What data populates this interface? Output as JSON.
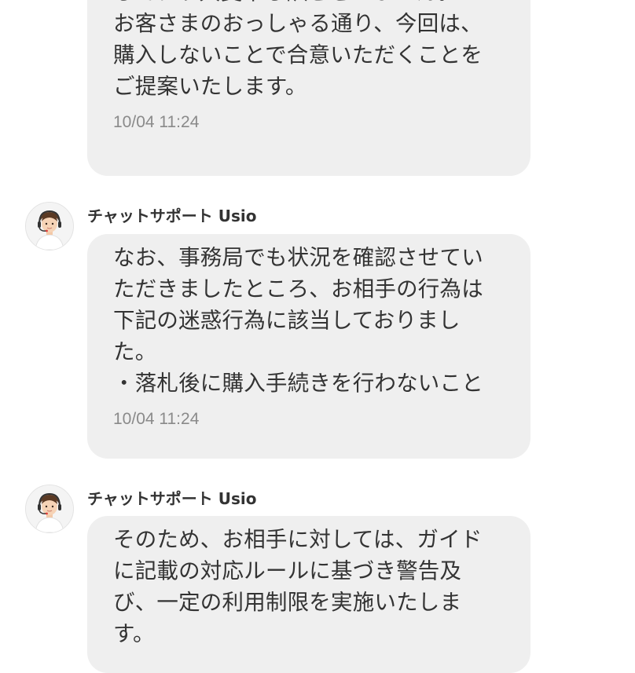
{
  "messages": [
    {
      "lines": [
        "しており大変申し訳ございません。",
        "お客さまのおっしゃる通り、今回は、",
        "購入しないことで合意いただくことを",
        "ご提案いたします。"
      ],
      "time": "10/04 11:24"
    },
    {
      "sender": "チャットサポート Usio",
      "avatar_icon": "support-agent-headset-icon",
      "lines": [
        "なお、事務局でも状況を確認させてい",
        "ただきましたところ、お相手の行為は",
        "下記の迷惑行為に該当しておりまし",
        "た。",
        "・落札後に購入手続きを行わないこと"
      ],
      "time": "10/04 11:24"
    },
    {
      "sender": "チャットサポート Usio",
      "avatar_icon": "support-agent-headset-icon",
      "lines": [
        "そのため、お相手に対しては、ガイド",
        "に記載の対応ルールに基づき警告及",
        "び、一定の利用制限を実施いたしま",
        "す。"
      ]
    }
  ]
}
